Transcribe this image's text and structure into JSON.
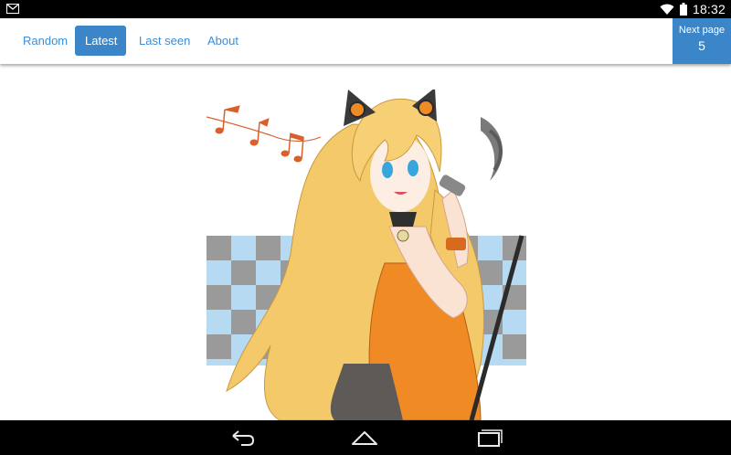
{
  "status_bar": {
    "time": "18:32",
    "icons": [
      "gmail-icon",
      "wifi-icon",
      "battery-icon"
    ]
  },
  "nav": {
    "tabs": [
      {
        "label": "Random",
        "active": false
      },
      {
        "label": "Latest",
        "active": true
      },
      {
        "label": "Last seen",
        "active": false
      },
      {
        "label": "About",
        "active": false
      }
    ],
    "next_page": {
      "label": "Next page",
      "number": "5"
    }
  },
  "colors": {
    "accent": "#3b86c9",
    "tab_text": "#3c8dd8",
    "hair": "#f4c96a",
    "dress": "#f08a24",
    "checker_blue": "#b7daf3",
    "checker_gray": "#9a9a9a",
    "notes": "#d9602a"
  },
  "system_nav": {
    "buttons": [
      "back-icon",
      "home-icon",
      "recents-icon"
    ]
  }
}
